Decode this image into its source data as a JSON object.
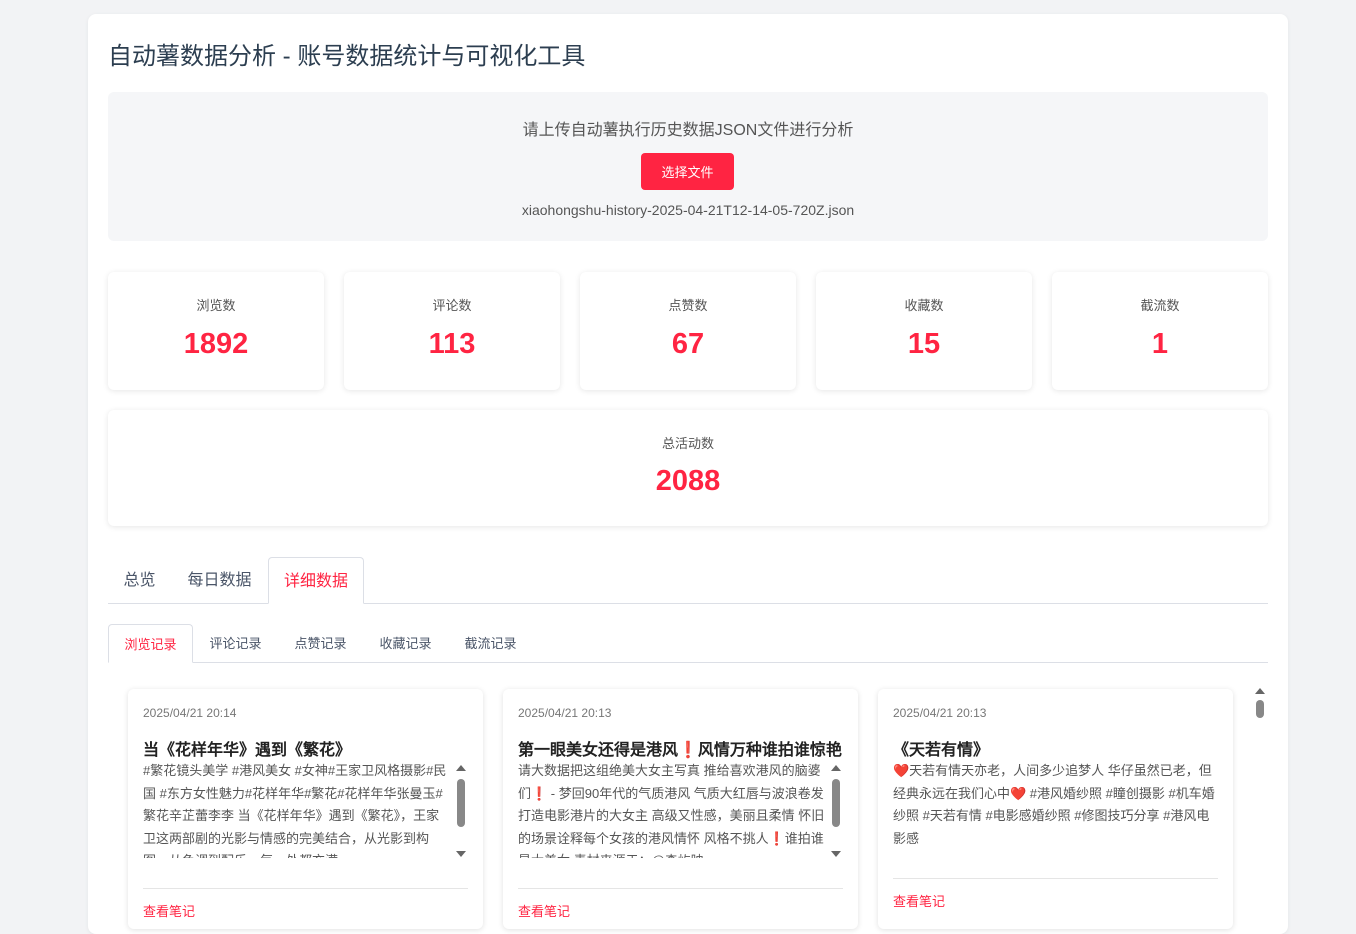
{
  "app": {
    "title": "自动薯数据分析 - 账号数据统计与可视化工具"
  },
  "upload": {
    "prompt": "请上传自动薯执行历史数据JSON文件进行分析",
    "button_label": "选择文件",
    "filename": "xiaohongshu-history-2025-04-21T12-14-05-720Z.json"
  },
  "stats": [
    {
      "label": "浏览数",
      "value": "1892"
    },
    {
      "label": "评论数",
      "value": "113"
    },
    {
      "label": "点赞数",
      "value": "67"
    },
    {
      "label": "收藏数",
      "value": "15"
    },
    {
      "label": "截流数",
      "value": "1"
    }
  ],
  "total": {
    "label": "总活动数",
    "value": "2088"
  },
  "main_tabs": [
    {
      "label": "总览",
      "active": false
    },
    {
      "label": "每日数据",
      "active": false
    },
    {
      "label": "详细数据",
      "active": true
    }
  ],
  "sub_tabs": [
    {
      "label": "浏览记录",
      "active": true
    },
    {
      "label": "评论记录",
      "active": false
    },
    {
      "label": "点赞记录",
      "active": false
    },
    {
      "label": "收藏记录",
      "active": false
    },
    {
      "label": "截流记录",
      "active": false
    }
  ],
  "records": [
    {
      "time": "2025/04/21 20:14",
      "title": "当《花样年华》遇到《繁花》",
      "desc": "#繁花镜头美学 #港风美女 #女神#王家卫风格摄影#民国 #东方女性魅力#花样年华#繁花#花样年华张曼玉#繁花辛芷蕾李李 当《花样年华》遇到《繁花》，王家卫这两部剧的光影与情感的完美结合，从光影到构图，从色调到配乐，每一处都充满",
      "link": "查看笔记"
    },
    {
      "time": "2025/04/21 20:13",
      "title": "第一眼美女还得是港风❗风情万种谁拍谁惊艳",
      "desc": "请大数据把这组绝美大女主写真 推给喜欢港风的脑婆们❗ - 梦回90年代的气质港风 气质大红唇与波浪卷发 打造电影港片的大女主 高级又性感，美丽且柔情 怀旧的场景诠释每个女孩的港风情怀 风格不挑人❗谁拍谁是大美女 素材来源于：@森屿映",
      "link": "查看笔记"
    },
    {
      "time": "2025/04/21 20:13",
      "title": "《天若有情》",
      "desc": "❤️天若有情天亦老，人间多少追梦人 华仔虽然已老，但经典永远在我们心中❤️ #港风婚纱照 #瞳创摄影 #机车婚纱照 #天若有情 #电影感婚纱照 #修图技巧分享 #港风电影感",
      "link": "查看笔记"
    }
  ]
}
